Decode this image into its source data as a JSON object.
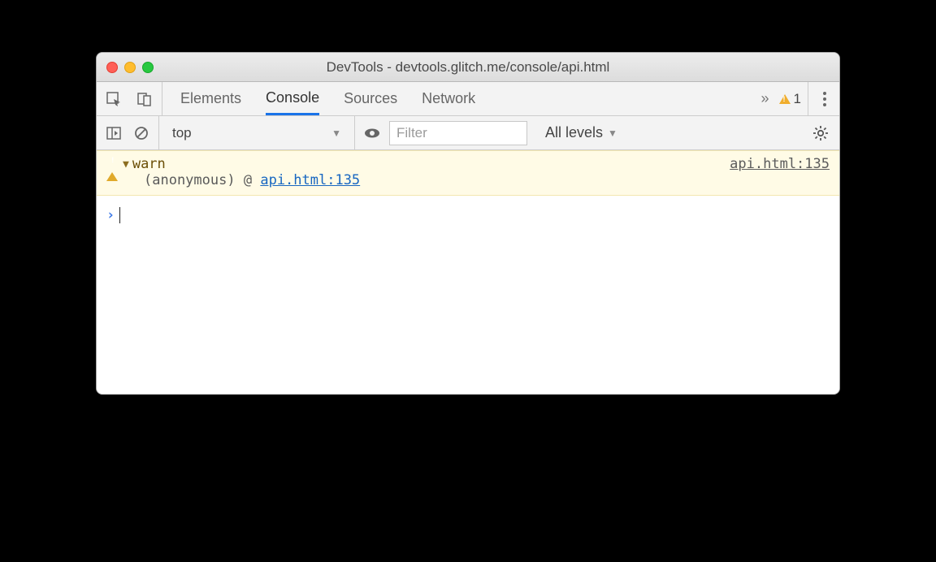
{
  "window": {
    "title": "DevTools - devtools.glitch.me/console/api.html"
  },
  "tabs": {
    "elements": "Elements",
    "console": "Console",
    "sources": "Sources",
    "network": "Network"
  },
  "warning_badge": {
    "count": "1"
  },
  "context": {
    "selected": "top"
  },
  "filter": {
    "placeholder": "Filter"
  },
  "levels": {
    "label": "All levels"
  },
  "log": {
    "warn": {
      "message": "warn",
      "source": "api.html:135",
      "trace_label": "(anonymous)",
      "trace_at": "@",
      "trace_link": "api.html:135"
    }
  }
}
